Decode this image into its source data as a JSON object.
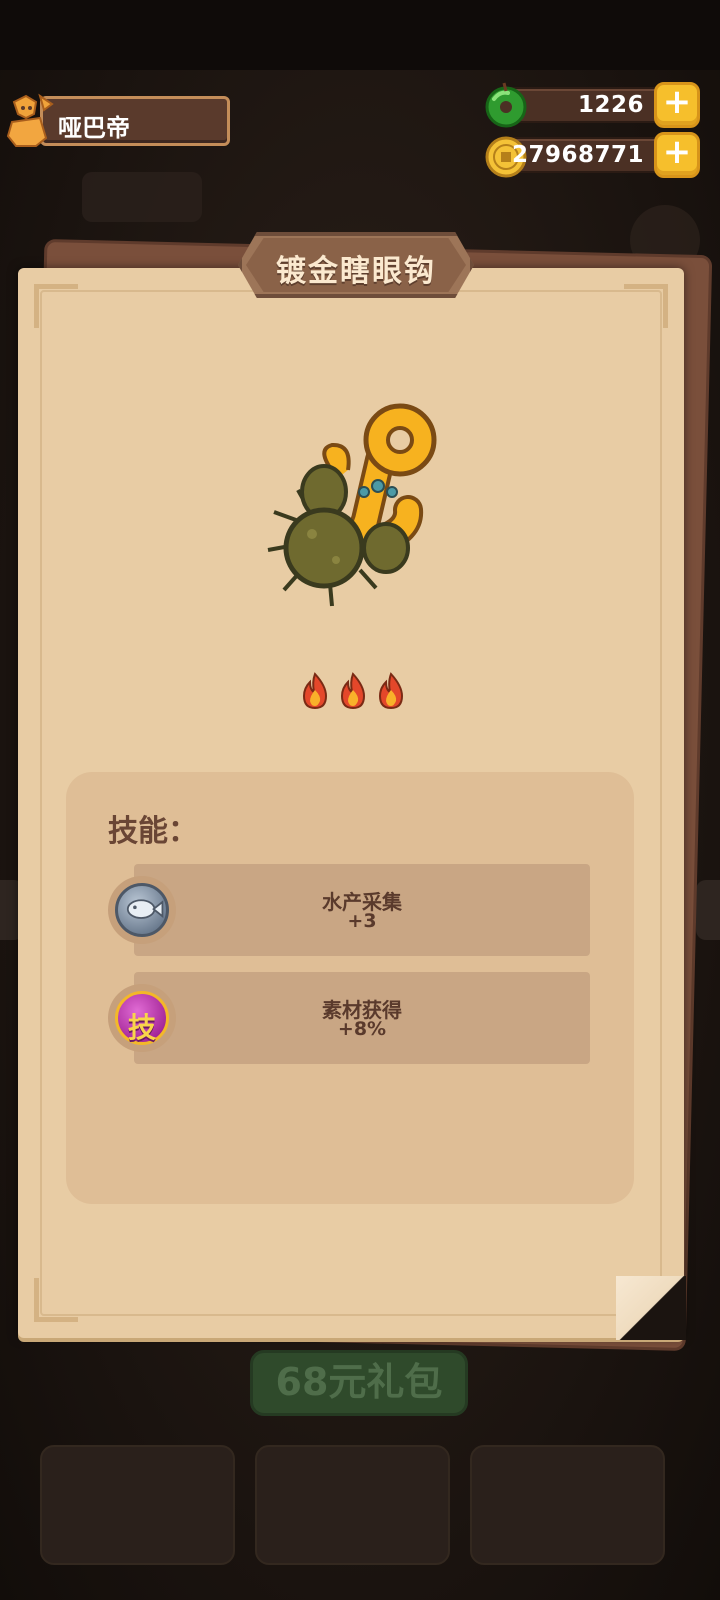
{
  "header": {
    "player_name": "哑巴帝",
    "currencies": [
      {
        "icon": "jade-icon",
        "amount": "1226"
      },
      {
        "icon": "gold-coin-icon",
        "amount": "27968771"
      }
    ],
    "plus_label": "+"
  },
  "background": {
    "gift_button_label": "68元礼包"
  },
  "item_dialog": {
    "title": "镀金瞎眼钩",
    "rarity_flames": 3,
    "skills_heading": "技能：",
    "skills": [
      {
        "icon": "fish-icon",
        "name": "水产采集",
        "value": "+3"
      },
      {
        "icon": "skill-tech-icon",
        "icon_text": "技",
        "name": "素材获得",
        "value": "+8%"
      }
    ]
  },
  "colors": {
    "paper": "#e8cca4",
    "panel": "#dfbe96",
    "row": "#c9a684",
    "text_brown": "#5a3a2c",
    "plus_yellow": "#f6bf2c"
  }
}
